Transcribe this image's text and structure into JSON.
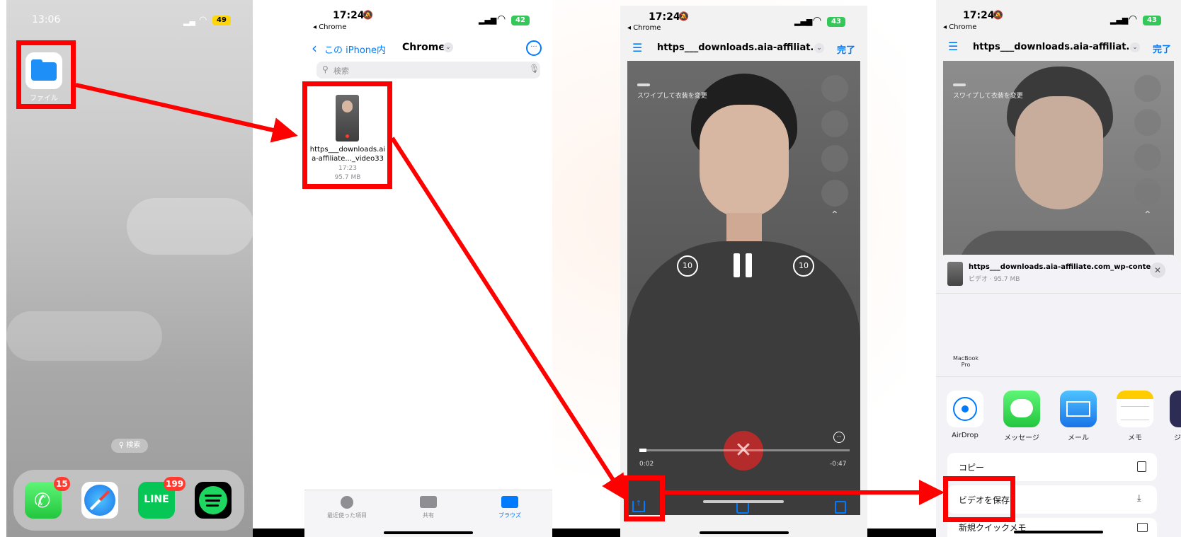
{
  "panel1": {
    "time": "13:06",
    "battery": "49",
    "files_app_label": "ファイル",
    "search_pill": "検索",
    "dock_badges": {
      "phone": "15",
      "line": "199"
    },
    "line_icon_text": "LINE"
  },
  "panel2": {
    "time": "17:24",
    "back_app": "◂ Chrome",
    "battery": "42",
    "back_label": "この iPhone内",
    "folder_title": "Chrome",
    "search_placeholder": "検索",
    "file": {
      "name_line1": "https___downloads.ai",
      "name_line2": "a-affiliate..._video33",
      "time": "17:23",
      "size": "95.7 MB"
    },
    "tabs": [
      "最近使った項目",
      "共有",
      "ブラウズ"
    ]
  },
  "panel3": {
    "time": "17:24",
    "back_app": "◂ Chrome",
    "battery": "43",
    "title": "https___downloads.aia-affiliat...",
    "done": "完了",
    "swipe_hint": "スワイプして衣装を変更",
    "time_elapsed": "0:02",
    "time_remaining": "-0:47",
    "skip_seconds": "10"
  },
  "panel4": {
    "time": "17:24",
    "back_app": "◂ Chrome",
    "battery": "43",
    "title": "https___downloads.aia-affiliat...",
    "done": "完了",
    "swipe_hint": "スワイプして衣装を変更",
    "share_title": "https___downloads.aia-affiliate.com_wp-conte...",
    "share_subtitle": "ビデオ · 95.7 MB",
    "airdrop_device": "MacBook Pro",
    "apps": [
      "AirDrop",
      "メッセージ",
      "メール",
      "メモ",
      "ジ"
    ],
    "actions": [
      "コピー",
      "ビデオを保存",
      "新規クイックメモ"
    ]
  },
  "colors": {
    "accent": "#ff0000",
    "ios_blue": "#007aff",
    "files_blue": "#1e8ff7"
  }
}
